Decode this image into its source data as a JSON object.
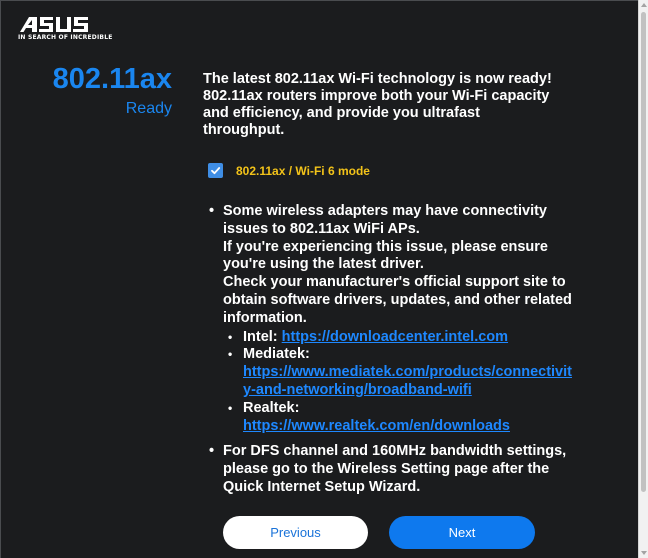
{
  "logo": {
    "brand": "ASUS",
    "tagline": "IN SEARCH OF INCREDIBLE"
  },
  "feature": {
    "title": "802.11ax",
    "status": "Ready"
  },
  "intro_text": "The latest 802.11ax Wi-Fi technology is now ready! 802.11ax routers improve both your Wi-Fi capacity and efficiency, and provide you ultrafast throughput.",
  "mode_option": {
    "label": "802.11ax / Wi-Fi 6 mode",
    "checked": true
  },
  "notes": {
    "compat_intro": "Some wireless adapters may have connectivity issues to 802.11ax WiFi APs.",
    "compat_line2": "If you're experiencing this issue, please ensure you're using the latest driver.",
    "compat_line3": "Check your manufacturer's official support site to obtain software drivers, updates, and other related information.",
    "vendors": [
      {
        "name": "Intel:",
        "url": "https://downloadcenter.intel.com"
      },
      {
        "name": "Mediatek:",
        "url": "https://www.mediatek.com/products/connectivity-and-networking/broadband-wifi"
      },
      {
        "name": "Realtek:",
        "url": "https://www.realtek.com/en/downloads"
      }
    ],
    "dfs_note": "For DFS channel and 160MHz bandwidth settings, please go to the Wireless Setting page after the Quick Internet Setup Wizard."
  },
  "buttons": {
    "previous": "Previous",
    "next": "Next"
  },
  "colors": {
    "background": "#1b1c1e",
    "accent_blue": "#1a86f0",
    "mode_label": "#f3c319",
    "link": "#1e88ff"
  },
  "icons": {
    "logo": "asus-logo",
    "checkbox": "checkmark-icon"
  }
}
